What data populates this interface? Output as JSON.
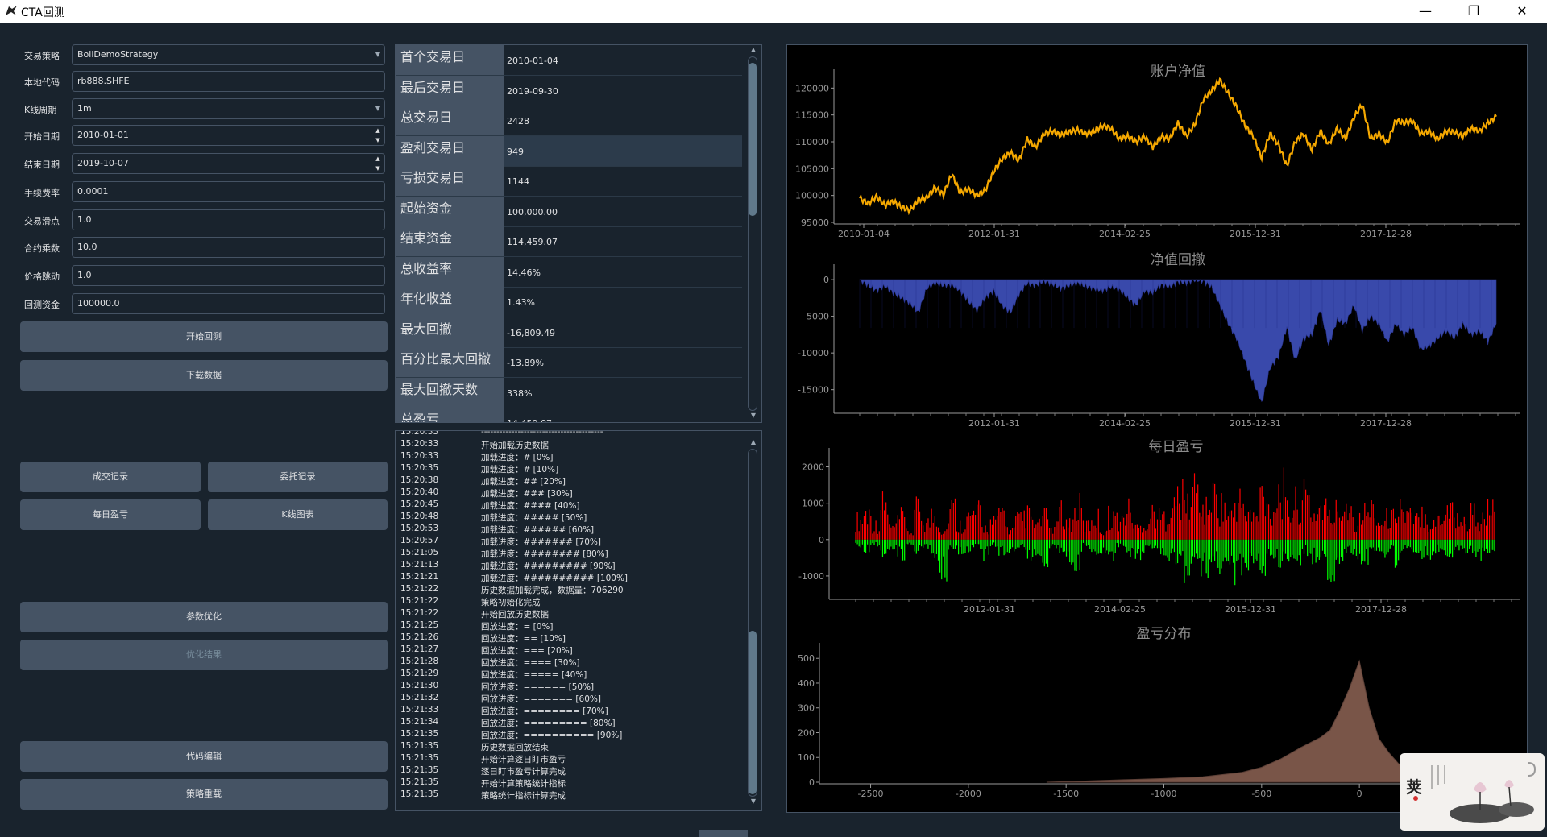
{
  "window": {
    "title": "CTA回测",
    "minimize": "—",
    "restore": "❐",
    "close": "✕"
  },
  "form": [
    {
      "label": "交易策略",
      "value": "BollDemoStrategy",
      "kind": "combo"
    },
    {
      "label": "本地代码",
      "value": "rb888.SHFE",
      "kind": "text"
    },
    {
      "label": "K线周期",
      "value": "1m",
      "kind": "combo"
    },
    {
      "label": "开始日期",
      "value": "2010-01-01",
      "kind": "date"
    },
    {
      "label": "结束日期",
      "value": "2019-10-07",
      "kind": "date"
    },
    {
      "label": "手续费率",
      "value": "0.0001",
      "kind": "text"
    },
    {
      "label": "交易滑点",
      "value": "1.0",
      "kind": "text"
    },
    {
      "label": "合约乘数",
      "value": "10.0",
      "kind": "text"
    },
    {
      "label": "价格跳动",
      "value": "1.0",
      "kind": "text"
    },
    {
      "label": "回测资金",
      "value": "100000.0",
      "kind": "text"
    }
  ],
  "buttons": {
    "start_backtest": "开始回测",
    "download_data": "下载数据",
    "trade_records": "成交记录",
    "order_records": "委托记录",
    "daily_pnl": "每日盈亏",
    "kline_chart": "K线图表",
    "param_optimize": "参数优化",
    "optimize_result": "优化结果",
    "code_edit": "代码编辑",
    "strategy_reload": "策略重载"
  },
  "stats": [
    {
      "key": "首个交易日",
      "value": "2010-01-04"
    },
    {
      "key": "最后交易日",
      "value": "2019-09-30"
    },
    {
      "key": "总交易日",
      "value": "2428"
    },
    {
      "key": "盈利交易日",
      "value": "949"
    },
    {
      "key": "亏损交易日",
      "value": "1144"
    },
    {
      "key": "起始资金",
      "value": "100,000.00"
    },
    {
      "key": "结束资金",
      "value": "114,459.07"
    },
    {
      "key": "总收益率",
      "value": "14.46%"
    },
    {
      "key": "年化收益",
      "value": "1.43%"
    },
    {
      "key": "最大回撤",
      "value": "-16,809.49"
    },
    {
      "key": "百分比最大回撤",
      "value": "-13.89%"
    },
    {
      "key": "最大回撤天数",
      "value": "338%"
    },
    {
      "key": "总盈亏",
      "value": "14,459.07"
    }
  ],
  "log": [
    {
      "time": "15:20:33",
      "msg": "----------------------------------------"
    },
    {
      "time": "15:20:33",
      "msg": "开始加载历史数据"
    },
    {
      "time": "15:20:33",
      "msg": "加载进度：# [0%]"
    },
    {
      "time": "15:20:35",
      "msg": "加载进度：# [10%]"
    },
    {
      "time": "15:20:38",
      "msg": "加载进度：## [20%]"
    },
    {
      "time": "15:20:40",
      "msg": "加载进度：### [30%]"
    },
    {
      "time": "15:20:45",
      "msg": "加载进度：#### [40%]"
    },
    {
      "time": "15:20:48",
      "msg": "加载进度：##### [50%]"
    },
    {
      "time": "15:20:53",
      "msg": "加载进度：###### [60%]"
    },
    {
      "time": "15:20:57",
      "msg": "加载进度：####### [70%]"
    },
    {
      "time": "15:21:05",
      "msg": "加载进度：######## [80%]"
    },
    {
      "time": "15:21:13",
      "msg": "加载进度：######### [90%]"
    },
    {
      "time": "15:21:21",
      "msg": "加载进度：########## [100%]"
    },
    {
      "time": "15:21:22",
      "msg": "历史数据加载完成，数据量：706290"
    },
    {
      "time": "15:21:22",
      "msg": "策略初始化完成"
    },
    {
      "time": "15:21:22",
      "msg": "开始回放历史数据"
    },
    {
      "time": "15:21:25",
      "msg": "回放进度：= [0%]"
    },
    {
      "time": "15:21:26",
      "msg": "回放进度：== [10%]"
    },
    {
      "time": "15:21:27",
      "msg": "回放进度：=== [20%]"
    },
    {
      "time": "15:21:28",
      "msg": "回放进度：==== [30%]"
    },
    {
      "time": "15:21:29",
      "msg": "回放进度：===== [40%]"
    },
    {
      "time": "15:21:30",
      "msg": "回放进度：====== [50%]"
    },
    {
      "time": "15:21:32",
      "msg": "回放进度：======= [60%]"
    },
    {
      "time": "15:21:33",
      "msg": "回放进度：======== [70%]"
    },
    {
      "time": "15:21:34",
      "msg": "回放进度：========= [80%]"
    },
    {
      "time": "15:21:35",
      "msg": "回放进度：========== [90%]"
    },
    {
      "time": "15:21:35",
      "msg": "历史数据回放结束"
    },
    {
      "time": "15:21:35",
      "msg": "开始计算逐日盯市盈亏"
    },
    {
      "time": "15:21:35",
      "msg": "逐日盯市盈亏计算完成"
    },
    {
      "time": "15:21:35",
      "msg": "开始计算策略统计指标"
    },
    {
      "time": "15:21:35",
      "msg": "策略统计指标计算完成"
    }
  ],
  "chart_data": [
    {
      "type": "line",
      "title": "账户净值",
      "x_ticks": [
        "2010-01-04",
        "2012-01-31",
        "2014-02-25",
        "2015-12-31",
        "2017-12-28"
      ],
      "y_ticks": [
        95000,
        100000,
        105000,
        110000,
        115000,
        120000
      ],
      "ylim": [
        95000,
        122000
      ],
      "color": "#f5a800",
      "series": [
        {
          "values": [
            99500,
            98500,
            99800,
            98200,
            98900,
            97800,
            97200,
            99200,
            99600,
            101500,
            100200,
            104000,
            100500,
            101200,
            100000,
            101000,
            104500,
            106800,
            108000,
            106500,
            110500,
            109000,
            111500,
            112000,
            111200,
            111800,
            112200,
            111500,
            112000,
            113000,
            112500,
            110500,
            111000,
            110000,
            111000,
            109000,
            111000,
            110500,
            113500,
            111000,
            113200,
            117800,
            119500,
            121500,
            119000,
            116500,
            113000,
            111000,
            107000,
            111500,
            109500,
            105500,
            110000,
            111500,
            108500,
            112000,
            109500,
            112500,
            110500,
            114500,
            117000,
            110500,
            111500,
            109800,
            114000,
            113500,
            113800,
            111500,
            112000,
            110500,
            112000,
            111800,
            111000,
            112500,
            112000,
            113500,
            114700
          ]
        }
      ]
    },
    {
      "type": "area",
      "title": "净值回撤",
      "x_ticks": [
        "2012-01-31",
        "2014-02-25",
        "2015-12-31",
        "2017-12-28"
      ],
      "y_ticks": [
        0,
        -5000,
        -10000,
        -15000
      ],
      "ylim": [
        -18000,
        1000
      ],
      "color": "#3949ab",
      "series": [
        {
          "values": [
            0,
            -800,
            -1500,
            -900,
            -1800,
            -2500,
            -3200,
            -4500,
            -1200,
            -500,
            -800,
            -700,
            -1500,
            -3000,
            -4200,
            -2500,
            -1500,
            -3500,
            -4500,
            -2000,
            -500,
            -800,
            -200,
            -600,
            -1200,
            -800,
            -500,
            -900,
            -1200,
            -1500,
            -1000,
            -1400,
            -2500,
            -3500,
            -1500,
            -1800,
            -700,
            -1000,
            -300,
            -500,
            0,
            -200,
            -1000,
            -3500,
            -6000,
            -8000,
            -11000,
            -14000,
            -16800,
            -12000,
            -10500,
            -6500,
            -11000,
            -8000,
            -7500,
            -4000,
            -9000,
            -5500,
            -6000,
            -3500,
            -7000,
            -5000,
            -6000,
            -8500,
            -6000,
            -7500,
            -6500,
            -9500,
            -9000,
            -8000,
            -7000,
            -8000,
            -6000,
            -7500,
            -7000,
            -8500,
            -6000
          ]
        }
      ]
    },
    {
      "type": "bar",
      "title": "每日盈亏",
      "x_ticks": [
        "2012-01-31",
        "2014-02-25",
        "2015-12-31",
        "2017-12-28"
      ],
      "y_ticks": [
        2000,
        1000,
        0,
        -1000
      ],
      "ylim": [
        -1600,
        2300
      ],
      "colors": {
        "profit": "#ff0000",
        "loss": "#00ff00"
      },
      "series": [
        {
          "values": [
            800,
            1100,
            600,
            1400,
            500,
            900,
            300,
            1200,
            700,
            1000,
            400,
            1300,
            600,
            900,
            1100,
            500,
            700,
            1200,
            400,
            800,
            1000,
            600,
            900,
            500,
            1100,
            700,
            1300,
            600,
            900,
            400,
            1000,
            800,
            1200,
            500,
            700,
            1100,
            900,
            1300,
            1700,
            1500,
            2100,
            1200,
            1800,
            1400,
            1000,
            1600,
            1100,
            900,
            1900,
            1300,
            2000,
            1200,
            1500,
            1700,
            1100,
            1400,
            900,
            1200,
            1600,
            800,
            1100,
            1300,
            700,
            900,
            1500,
            1000,
            800,
            1200,
            600,
            1000,
            1400,
            900,
            700,
            1100,
            800,
            1200
          ]
        },
        {
          "values": [
            -300,
            -400,
            -200,
            -500,
            -300,
            -600,
            -200,
            -400,
            -300,
            -700,
            -1400,
            -300,
            -500,
            -400,
            -300,
            -600,
            -200,
            -500,
            -400,
            -300,
            -600,
            -500,
            -800,
            -300,
            -400,
            -700,
            -1000,
            -300,
            -500,
            -400,
            -600,
            -300,
            -500,
            -700,
            -400,
            -300,
            -500,
            -600,
            -800,
            -1200,
            -900,
            -1100,
            -700,
            -1000,
            -800,
            -1300,
            -900,
            -700,
            -1000,
            -600,
            -800,
            -700,
            -900,
            -500,
            -700,
            -600,
            -1500,
            -800,
            -500,
            -600,
            -700,
            -400,
            -600,
            -500,
            -800,
            -400,
            -500,
            -600,
            -700,
            -400,
            -500,
            -300,
            -400,
            -500,
            -600,
            -400
          ]
        }
      ]
    },
    {
      "type": "area",
      "title": "盈亏分布",
      "x_ticks": [
        -2500,
        -2000,
        -1500,
        -1000,
        -500,
        0,
        500
      ],
      "y_ticks": [
        0,
        100,
        200,
        300,
        400,
        500
      ],
      "xlim": [
        -2700,
        700
      ],
      "ylim": [
        0,
        530
      ],
      "color": "#795548",
      "series": [
        {
          "x": [
            -1600,
            -1400,
            -1200,
            -1000,
            -800,
            -600,
            -500,
            -400,
            -300,
            -200,
            -150,
            -100,
            -50,
            0,
            50,
            100,
            150,
            200,
            300,
            400,
            500,
            600,
            700
          ],
          "values": [
            0,
            5,
            10,
            15,
            22,
            40,
            60,
            95,
            140,
            180,
            210,
            290,
            380,
            490,
            300,
            175,
            120,
            75,
            40,
            25,
            15,
            8,
            5
          ]
        }
      ]
    }
  ],
  "logo": {
    "text": "荚"
  }
}
